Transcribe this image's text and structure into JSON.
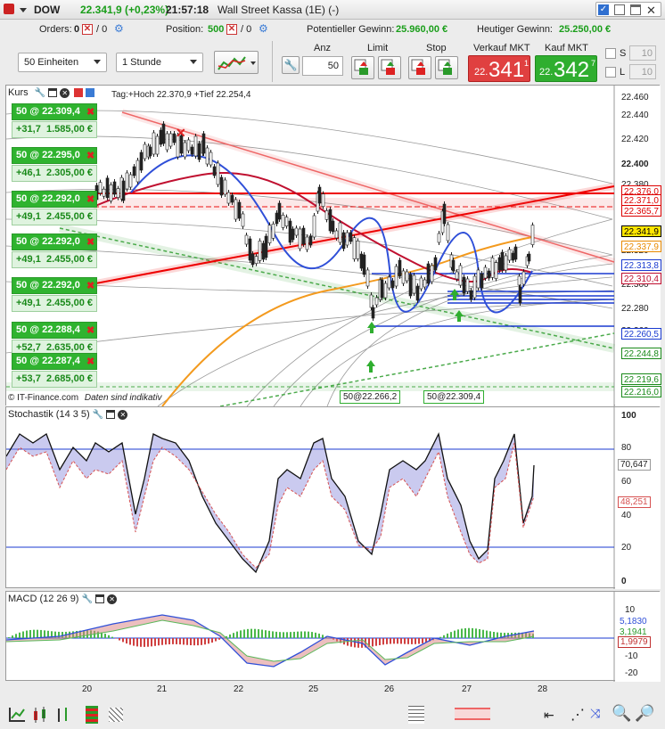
{
  "header": {
    "instrument": "DOW",
    "change": "22.341,9 (+0,23%)",
    "time": "21:57:18",
    "exchange": "Wall Street Kassa (1E) (-)"
  },
  "status": {
    "orders_label": "Orders:",
    "orders_val": "0",
    "orders_val2": "/ 0",
    "position_label": "Position:",
    "position_val": "500",
    "position_val2": "/ 0",
    "pot_label": "Potentieller Gewinn:",
    "pot_val": "25.960,00 €",
    "today_label": "Heutiger Gewinn:",
    "today_val": "25.250,00 €"
  },
  "toolbar": {
    "units": "50 Einheiten",
    "interval": "1 Stunde",
    "anz_label": "Anz",
    "anz_val": "50",
    "limit_label": "Limit",
    "stop_label": "Stop",
    "sell_label": "Verkauf MKT",
    "buy_label": "Kauf MKT",
    "sell_small": "22.",
    "sell_big": "341",
    "sell_sup": "1",
    "buy_small": "22.",
    "buy_big": "342",
    "buy_sup": "7",
    "s_label": "S",
    "s_val": "10",
    "l_label": "L",
    "l_val": "10"
  },
  "kurs": {
    "title": "Kurs",
    "hoch_tief": "Tag:+Hoch 22.370,9 +Tief 22.254,4",
    "footer": "© IT-Finance.com",
    "footer_italic": "Daten sind indikativ",
    "tag1": "50@22.266,2",
    "tag2": "50@22.309,4"
  },
  "orders": [
    {
      "l1": "50 @ 22.309,4",
      "l2": "+31,7",
      "l3": "1.585,00 €"
    },
    {
      "l1": "50 @ 22.295,0",
      "l2": "+46,1",
      "l3": "2.305,00 €"
    },
    {
      "l1": "50 @ 22.292,0",
      "l2": "+49,1",
      "l3": "2.455,00 €"
    },
    {
      "l1": "50 @ 22.292,0",
      "l2": "+49,1",
      "l3": "2.455,00 €"
    },
    {
      "l1": "50 @ 22.292,0",
      "l2": "+49,1",
      "l3": "2.455,00 €"
    },
    {
      "l1": "50 @ 22.288,4",
      "l2": "+52,7",
      "l3": "2.635,00 €"
    },
    {
      "l1": "50 @ 22.287,4",
      "l2": "+53,7",
      "l3": "2.685,00 €"
    }
  ],
  "price_axis": [
    "22.460",
    "22.440",
    "22.420",
    "22.400",
    "22.380",
    "22.360",
    "22.340",
    "22.320",
    "22.300",
    "22.280",
    "22.260",
    "22.240",
    "22.220"
  ],
  "price_tags": [
    {
      "v": "22.376,0",
      "c": "#d00"
    },
    {
      "v": "22.371,0",
      "c": "#d00"
    },
    {
      "v": "22.365,7",
      "c": "#d00"
    },
    {
      "v": "22.341,9",
      "c": "#000",
      "bg": "#ffe600"
    },
    {
      "v": "22.337,9",
      "c": "#e88a00"
    },
    {
      "v": "22.313,8",
      "c": "#1a3ad0"
    },
    {
      "v": "22.310,4",
      "c": "#c01030"
    },
    {
      "v": "22.260,5",
      "c": "#1a3ad0"
    },
    {
      "v": "22.244,8",
      "c": "#1a8a1a"
    },
    {
      "v": "22.219,6",
      "c": "#1a8a1a"
    },
    {
      "v": "22.216,0",
      "c": "#1a8a1a"
    }
  ],
  "stoch": {
    "title": "Stochastik (14 3 5)",
    "axis": [
      "100",
      "80",
      "60",
      "40",
      "20",
      "0"
    ],
    "tag1": "70,647",
    "tag2": "48,251"
  },
  "macd": {
    "title": "MACD (12 26 9)",
    "axis": [
      "10",
      "0",
      "-10",
      "-20"
    ],
    "tag1": "5,1830",
    "tag2": "3,1941",
    "tag3": "1,9979"
  },
  "x_axis": [
    "20",
    "21",
    "22",
    "25",
    "26",
    "27",
    "28"
  ]
}
